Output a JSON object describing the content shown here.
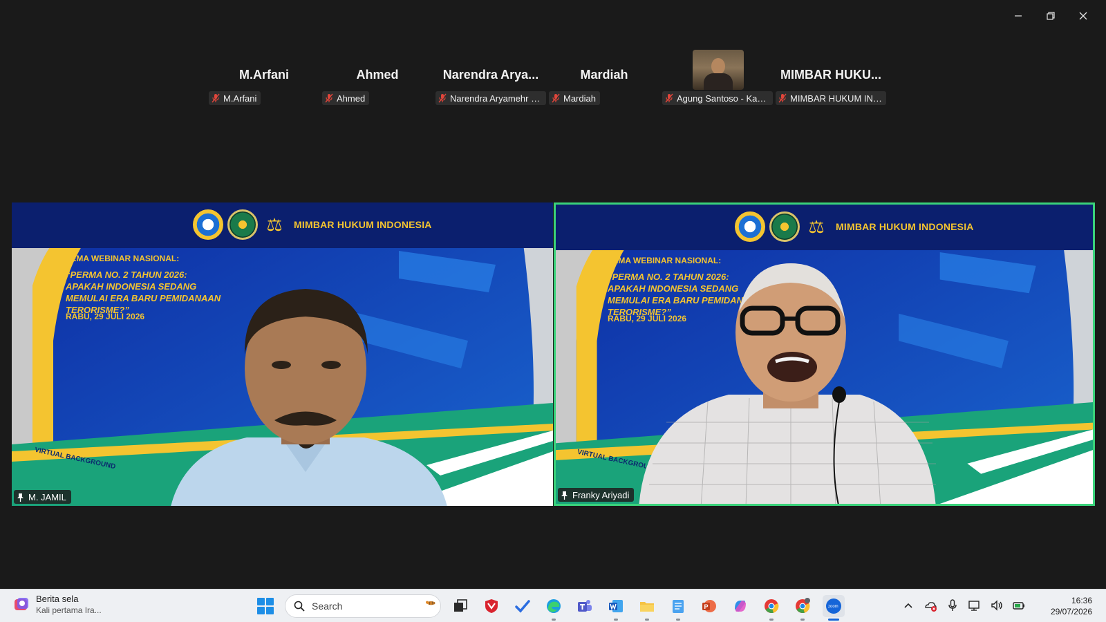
{
  "window": {
    "minimize": "minimize",
    "restore": "restore",
    "close": "close"
  },
  "participants": [
    {
      "display_name": "M.Arfani",
      "label": "M.Arfani"
    },
    {
      "display_name": "Ahmed",
      "label": "Ahmed"
    },
    {
      "display_name": "Narendra Arya...",
      "label": "Narendra Aryamehr R..."
    },
    {
      "display_name": "Mardiah",
      "label": "Mardiah"
    },
    {
      "display_name": "",
      "label": "Agung Santoso - Kam..."
    },
    {
      "display_name": "MIMBAR HUKU...",
      "label": "MIMBAR HUKUM IND..."
    }
  ],
  "slide": {
    "brand": "MIMBAR HUKUM INDONESIA",
    "theme": "TEMA WEBINAR NASIONAL:",
    "title": "“PERMA NO. 2 TAHUN 2026: APAKAH INDONESIA SEDANG MEMULAI ERA BARU PEMIDANAAN TERORISME?”",
    "date": "RABU, 29 JULI 2026",
    "virtual_bg": "VIRTUAL BACKGROUND"
  },
  "videos": [
    {
      "name": "M. JAMIL",
      "speaking": false
    },
    {
      "name": "Franky Ariyadi",
      "speaking": true
    }
  ],
  "colors": {
    "speaker_border": "#3ad37b",
    "slide_blue": "#0c2f8f",
    "slide_gold": "#f4c430",
    "slide_teal": "#1aa37a"
  },
  "taskbar": {
    "news_title": "Berita sela",
    "news_sub": "Kali pertama Ira...",
    "search_placeholder": "Search",
    "time": "16:36",
    "date": "29/07/2026"
  }
}
